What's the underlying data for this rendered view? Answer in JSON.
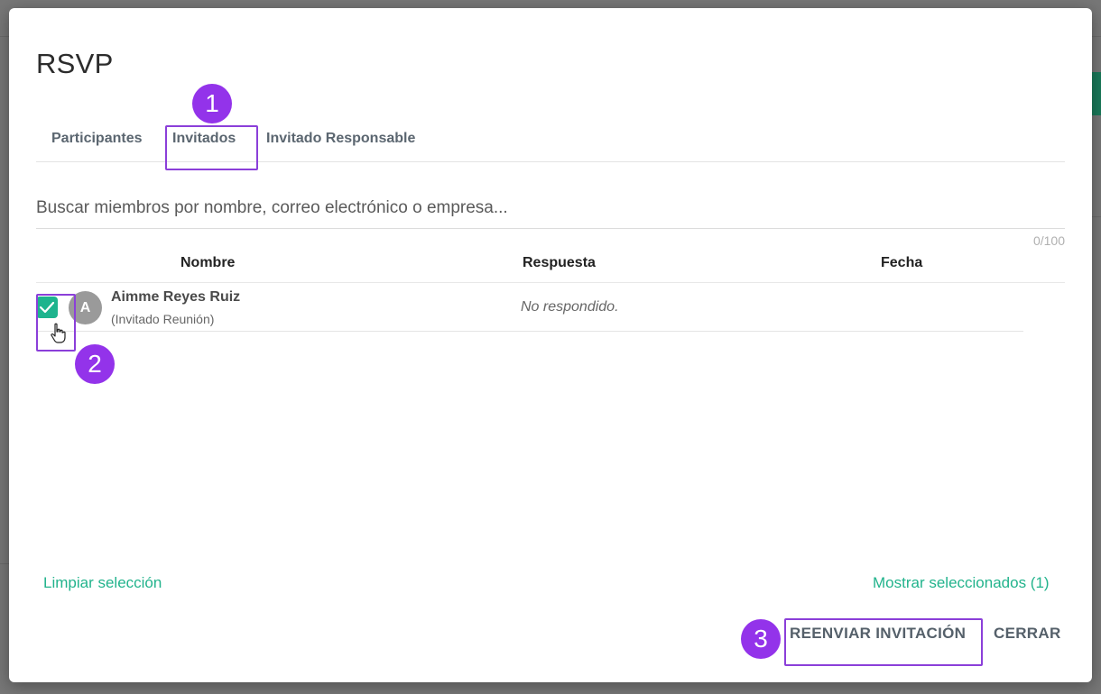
{
  "dialog": {
    "title": "RSVP",
    "tabs": [
      {
        "label": "Participantes"
      },
      {
        "label": "Invitados"
      },
      {
        "label": "Invitado Responsable"
      }
    ],
    "active_tab": "Invitados",
    "search": {
      "placeholder": "Buscar miembros por nombre, correo electrónico o empresa...",
      "value": "",
      "counter": "0/100"
    },
    "table": {
      "columns": [
        "Nombre",
        "Respuesta",
        "Fecha"
      ],
      "rows": [
        {
          "checked": true,
          "avatar_initial": "A",
          "name": "Aimme Reyes Ruiz",
          "role": "(Invitado Reunión)",
          "response": "No respondido.",
          "date": ""
        }
      ]
    },
    "links": {
      "clear": "Limpiar selección",
      "show_selected": "Mostrar seleccionados (1)"
    },
    "buttons": {
      "resend": "REENVIAR INVITACIÓN",
      "close": "CERRAR"
    }
  },
  "annotations": {
    "steps": [
      "1",
      "2",
      "3"
    ]
  },
  "colors": {
    "accent": "#1eb48e",
    "annotation": "#9333ea",
    "overlay": "#7d7d7d"
  }
}
